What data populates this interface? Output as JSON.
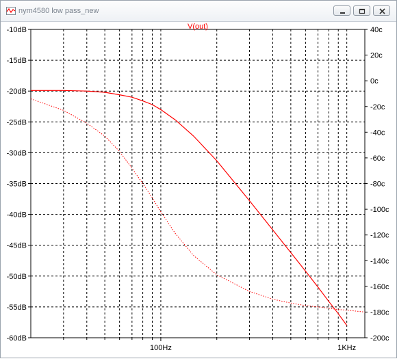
{
  "window": {
    "title": "nym4580 low pass_new",
    "buttons": [
      "minimize",
      "restore",
      "close"
    ]
  },
  "colors": {
    "trace": "#ff0000",
    "grid": "#000000",
    "axis_text": "#000000",
    "title_text": "#7c8590"
  },
  "chart_data": {
    "type": "line",
    "title": "V(out)",
    "x_scale": "log",
    "xlim": [
      20,
      1250
    ],
    "x_ticks": [
      {
        "value": 100,
        "label": "100Hz"
      },
      {
        "value": 1000,
        "label": "1KHz"
      }
    ],
    "x_minor_ticks": [
      30,
      40,
      50,
      60,
      70,
      80,
      90,
      200,
      300,
      400,
      500,
      600,
      700,
      800,
      900
    ],
    "ylim_left": [
      -60,
      -10
    ],
    "left_ticks": [
      "-10dB",
      "-15dB",
      "-20dB",
      "-25dB",
      "-30dB",
      "-35dB",
      "-40dB",
      "-45dB",
      "-50dB",
      "-55dB",
      "-60dB"
    ],
    "ylim_right": [
      -200,
      40
    ],
    "right_ticks": [
      "40c",
      "20c",
      "0c",
      "-20c",
      "-40c",
      "-60c",
      "-80c",
      "-100c",
      "-120c",
      "-140c",
      "-160c",
      "-180c",
      "-200c"
    ],
    "grid": true,
    "series": [
      {
        "name": "V(out)",
        "style": "solid",
        "axis": "left",
        "x": [
          20,
          30,
          40,
          50,
          60,
          70,
          80,
          90,
          100,
          120,
          150,
          200,
          300,
          400,
          500,
          600,
          700,
          800,
          900,
          1000
        ],
        "y": [
          -19.9,
          -19.9,
          -20.0,
          -20.2,
          -20.6,
          -21.0,
          -21.6,
          -22.2,
          -23.0,
          -24.7,
          -27.3,
          -31.3,
          -37.8,
          -42.5,
          -46.2,
          -49.2,
          -51.8,
          -54.1,
          -56.1,
          -58.0
        ]
      },
      {
        "name": "",
        "style": "dotted",
        "axis": "right",
        "x": [
          20,
          30,
          40,
          50,
          60,
          70,
          80,
          90,
          100,
          120,
          150,
          200,
          300,
          400,
          500,
          600,
          700,
          800,
          900,
          1000,
          1250
        ],
        "y": [
          -14,
          -23,
          -33,
          -43,
          -55,
          -68,
          -80,
          -91,
          -102,
          -119,
          -136,
          -151,
          -164,
          -170,
          -173,
          -175,
          -176,
          -177,
          -178,
          -178.5,
          -180
        ]
      }
    ]
  }
}
